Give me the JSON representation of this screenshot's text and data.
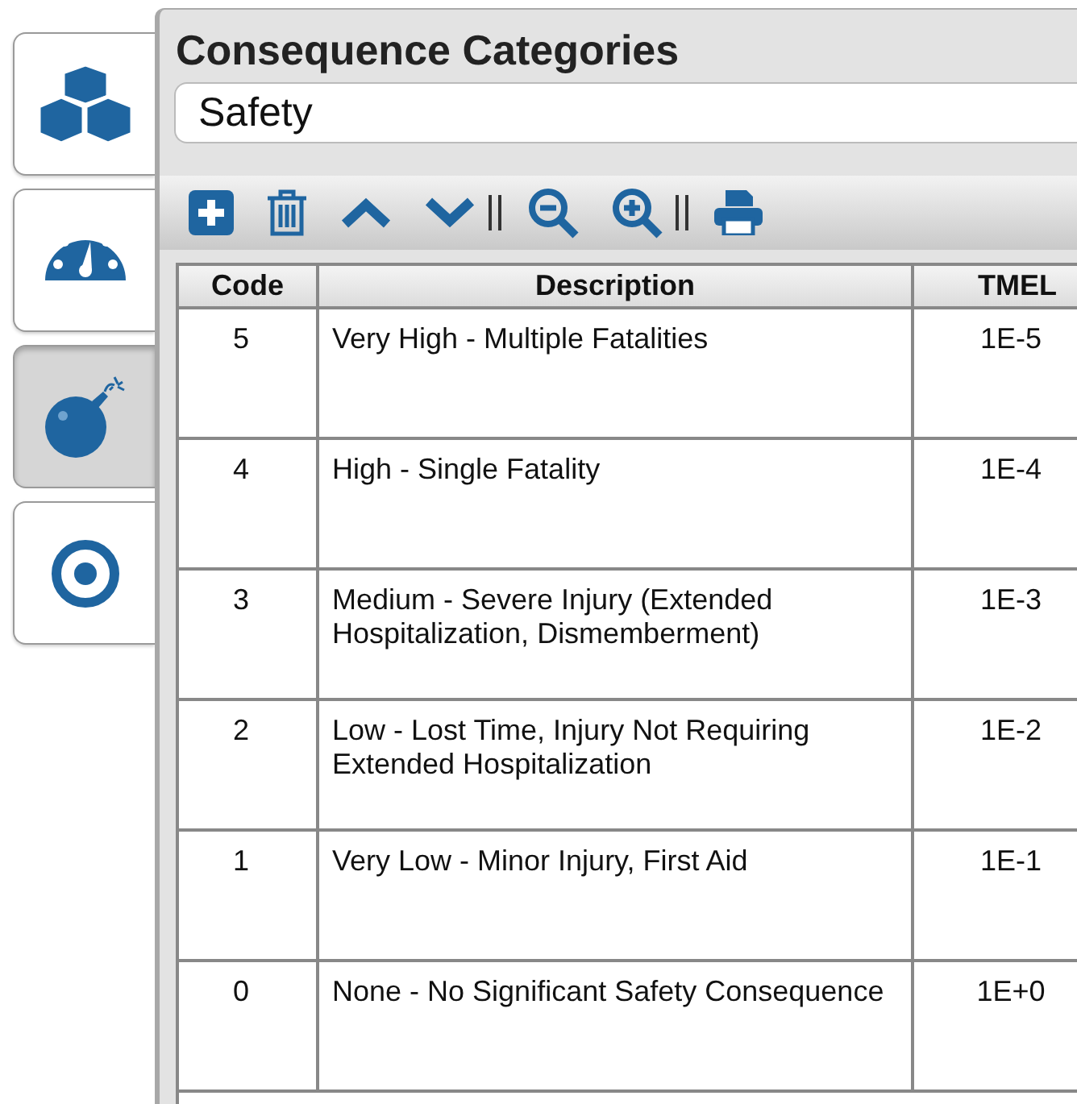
{
  "sidebar": {
    "tabs": [
      {
        "kind": "cubes",
        "selected": false
      },
      {
        "kind": "gauge",
        "selected": false
      },
      {
        "kind": "bomb",
        "selected": true
      },
      {
        "kind": "target",
        "selected": false
      }
    ]
  },
  "panel": {
    "title": "Consequence Categories",
    "category_field": {
      "value": "Safety"
    },
    "toolbar": [
      {
        "kind": "add"
      },
      {
        "kind": "delete"
      },
      {
        "kind": "up"
      },
      {
        "kind": "down"
      },
      {
        "kind": "separator"
      },
      {
        "kind": "zoom-out"
      },
      {
        "kind": "zoom-in"
      },
      {
        "kind": "separator"
      },
      {
        "kind": "print"
      }
    ],
    "table": {
      "columns": [
        "Code",
        "Description",
        "TMEL"
      ],
      "rows": [
        {
          "code": "5",
          "description": "Very High - Multiple Fatalities",
          "tmel": "1E-5"
        },
        {
          "code": "4",
          "description": "High - Single Fatality",
          "tmel": "1E-4"
        },
        {
          "code": "3",
          "description": "Medium - Severe Injury (Extended Hospitalization, Dismemberment)",
          "tmel": "1E-3"
        },
        {
          "code": "2",
          "description": "Low - Lost Time, Injury Not Requiring Extended Hospitalization",
          "tmel": "1E-2"
        },
        {
          "code": "1",
          "description": "Very Low - Minor Injury, First Aid",
          "tmel": "1E-1"
        },
        {
          "code": "0",
          "description": "None - No Significant Safety Consequence",
          "tmel": "1E+0"
        }
      ]
    }
  }
}
